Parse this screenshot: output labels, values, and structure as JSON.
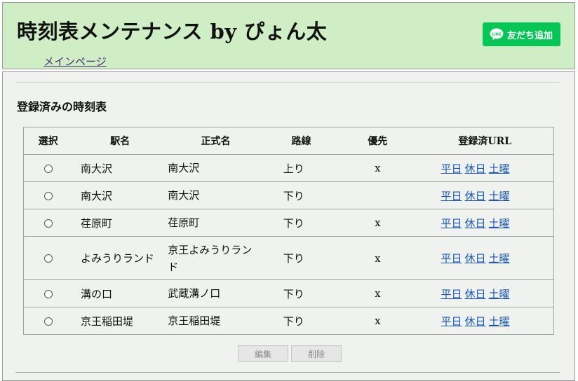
{
  "header": {
    "title_main": "時刻表メンテナンス",
    "title_by": "by",
    "title_author": "ぴょん太",
    "main_link": "メインページ",
    "line_button_label": "友だち追加",
    "line_icon_text": "LINE",
    "line_color": "#06c755",
    "header_bg": "#d0eec6"
  },
  "section": {
    "title": "登録済みの時刻表"
  },
  "table": {
    "headers": {
      "select": "選択",
      "station": "駅名",
      "formal": "正式名",
      "line": "路線",
      "priority": "優先",
      "url": "登録済URL"
    },
    "rows": [
      {
        "station": "南大沢",
        "formal": "南大沢",
        "line": "上り",
        "priority": "x",
        "links": [
          "平日",
          "休日",
          "土曜"
        ]
      },
      {
        "station": "南大沢",
        "formal": "南大沢",
        "line": "下り",
        "priority": "",
        "links": [
          "平日",
          "休日",
          "土曜"
        ]
      },
      {
        "station": "荏原町",
        "formal": "荏原町",
        "line": "下り",
        "priority": "x",
        "links": [
          "平日",
          "休日",
          "土曜"
        ]
      },
      {
        "station": "よみうりランド",
        "formal": "京王よみうりランド",
        "line": "下り",
        "priority": "x",
        "links": [
          "平日",
          "休日",
          "土曜"
        ]
      },
      {
        "station": "溝の口",
        "formal": "武蔵溝ノ口",
        "line": "下り",
        "priority": "x",
        "links": [
          "平日",
          "休日",
          "土曜"
        ]
      },
      {
        "station": "京王稲田堤",
        "formal": "京王稲田堤",
        "line": "下り",
        "priority": "x",
        "links": [
          "平日",
          "休日",
          "土曜"
        ]
      }
    ]
  },
  "buttons": {
    "edit": "編集",
    "delete": "削除"
  },
  "colors": {
    "link": "#1a58b8",
    "content_bg": "#eff2ee"
  }
}
